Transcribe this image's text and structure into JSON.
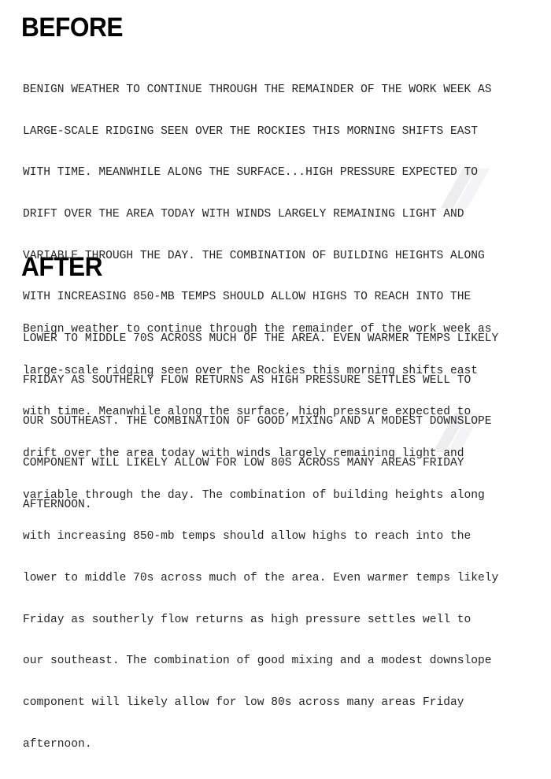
{
  "page": {
    "background_color": "#ffffff",
    "text_color": "#262626",
    "heading_color": "#000000",
    "watermark_color": "#e9e9ec"
  },
  "sections": [
    {
      "id": "before",
      "heading": "BEFORE",
      "lines": [
        "BENIGN WEATHER TO CONTINUE THROUGH THE REMAINDER OF THE WORK WEEK AS",
        "LARGE-SCALE RIDGING SEEN OVER THE ROCKIES THIS MORNING SHIFTS EAST",
        "WITH TIME. MEANWHILE ALONG THE SURFACE...HIGH PRESSURE EXPECTED TO",
        "DRIFT OVER THE AREA TODAY WITH WINDS LARGELY REMAINING LIGHT AND",
        "VARIABLE THROUGH THE DAY. THE COMBINATION OF BUILDING HEIGHTS ALONG",
        "WITH INCREASING 850-MB TEMPS SHOULD ALLOW HIGHS TO REACH INTO THE",
        "LOWER TO MIDDLE 70S ACROSS MUCH OF THE AREA. EVEN WARMER TEMPS LIKELY",
        "FRIDAY AS SOUTHERLY FLOW RETURNS AS HIGH PRESSURE SETTLES WELL TO",
        "OUR SOUTHEAST. THE COMBINATION OF GOOD MIXING AND A MODEST DOWNSLOPE",
        "COMPONENT WILL LIKELY ALLOW FOR LOW 80S ACROSS MANY AREAS FRIDAY",
        "AFTERNOON."
      ]
    },
    {
      "id": "after",
      "heading": "AFTER",
      "lines": [
        "Benign weather to continue through the remainder of the work week as",
        "large-scale ridging seen over the Rockies this morning shifts east",
        "with time. Meanwhile along the surface, high pressure expected to",
        "drift over the area today with winds largely remaining light and",
        "variable through the day. The combination of building heights along",
        "with increasing 850-mb temps should allow highs to reach into the",
        "lower to middle 70s across much of the area. Even warmer temps likely",
        "Friday as southerly flow returns as high pressure settles well to",
        "our southeast. The combination of good mixing and a modest downslope",
        "component will likely allow for low 80s across many areas Friday",
        "afternoon."
      ]
    }
  ]
}
